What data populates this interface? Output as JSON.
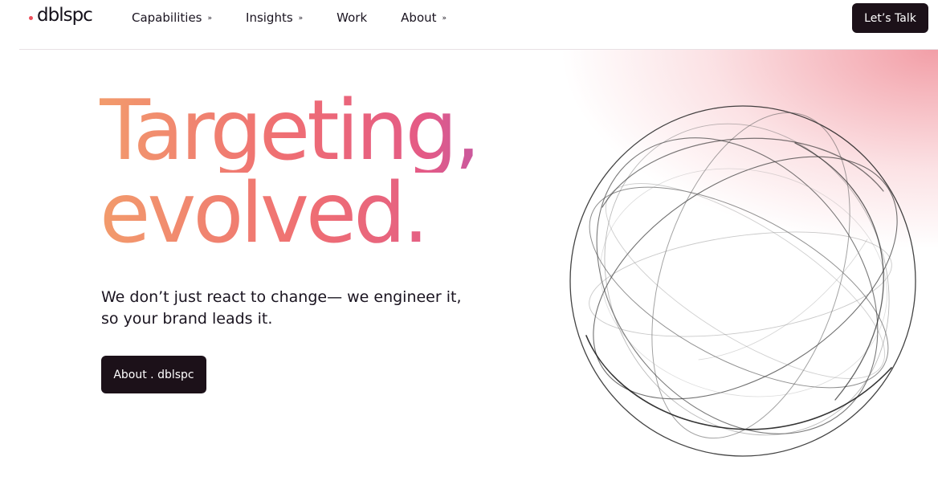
{
  "header": {
    "logo_text": "dblspc",
    "nav": [
      {
        "label": "Capabilities",
        "has_dropdown": true
      },
      {
        "label": "Insights",
        "has_dropdown": true
      },
      {
        "label": "Work",
        "has_dropdown": false
      },
      {
        "label": "About",
        "has_dropdown": true
      }
    ],
    "dropdown_glyph": "»",
    "cta_label": "Let’s Talk"
  },
  "hero": {
    "headline_line1": "Targeting,",
    "headline_line2": "evolved.",
    "subtext": "We don’t just react to change— we engineer it, so your brand leads it.",
    "cta_label": "About . dblspc",
    "graphic": "wire-sphere"
  },
  "colors": {
    "brand_dot": "#ee4f5b",
    "button_dark": "#1c1119",
    "gradient_start": "#f29b6c",
    "gradient_mid": "#e45a86",
    "gradient_end": "#9a57c8"
  }
}
